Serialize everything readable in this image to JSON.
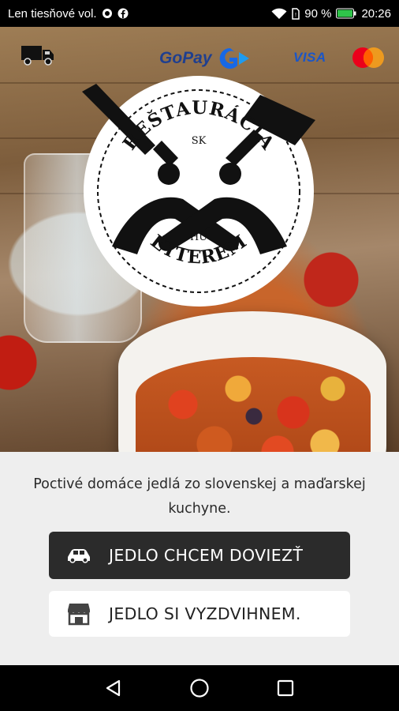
{
  "status_bar": {
    "carrier": "Len tiesňové vol.",
    "battery": "90 %",
    "time": "20:26",
    "icons": [
      "whatsapp-icon",
      "facebook-icon",
      "wifi-icon",
      "sim-icon",
      "battery-icon"
    ]
  },
  "header": {
    "payment_logos": {
      "gopay": "GoPay",
      "visa": "VISA"
    },
    "icons": [
      "delivery-truck-icon",
      "mastercard-icon"
    ]
  },
  "logo": {
    "top_text": "REŠTAURÁCIA",
    "badge_top": "SK",
    "badge_bottom": "HU",
    "bottom_text": "ÉTTEREM"
  },
  "panel": {
    "tagline": "Poctivé domáce jedlá zo slovenskej a maďarskej kuchyne.",
    "buttons": {
      "delivery_label": "JEDLO CHCEM DOVIEZŤ",
      "pickup_label": "JEDLO SI VYZDVIHNEM."
    },
    "icons": [
      "car-icon",
      "store-icon"
    ]
  },
  "nav_bar": {
    "icons": [
      "back-icon",
      "home-icon",
      "recents-icon"
    ]
  },
  "colors": {
    "primary_button": "#2b2b2b",
    "panel_background": "#eeeeee",
    "gopay_blue": "#1f3f8f",
    "visa_blue": "#1a56c8"
  }
}
